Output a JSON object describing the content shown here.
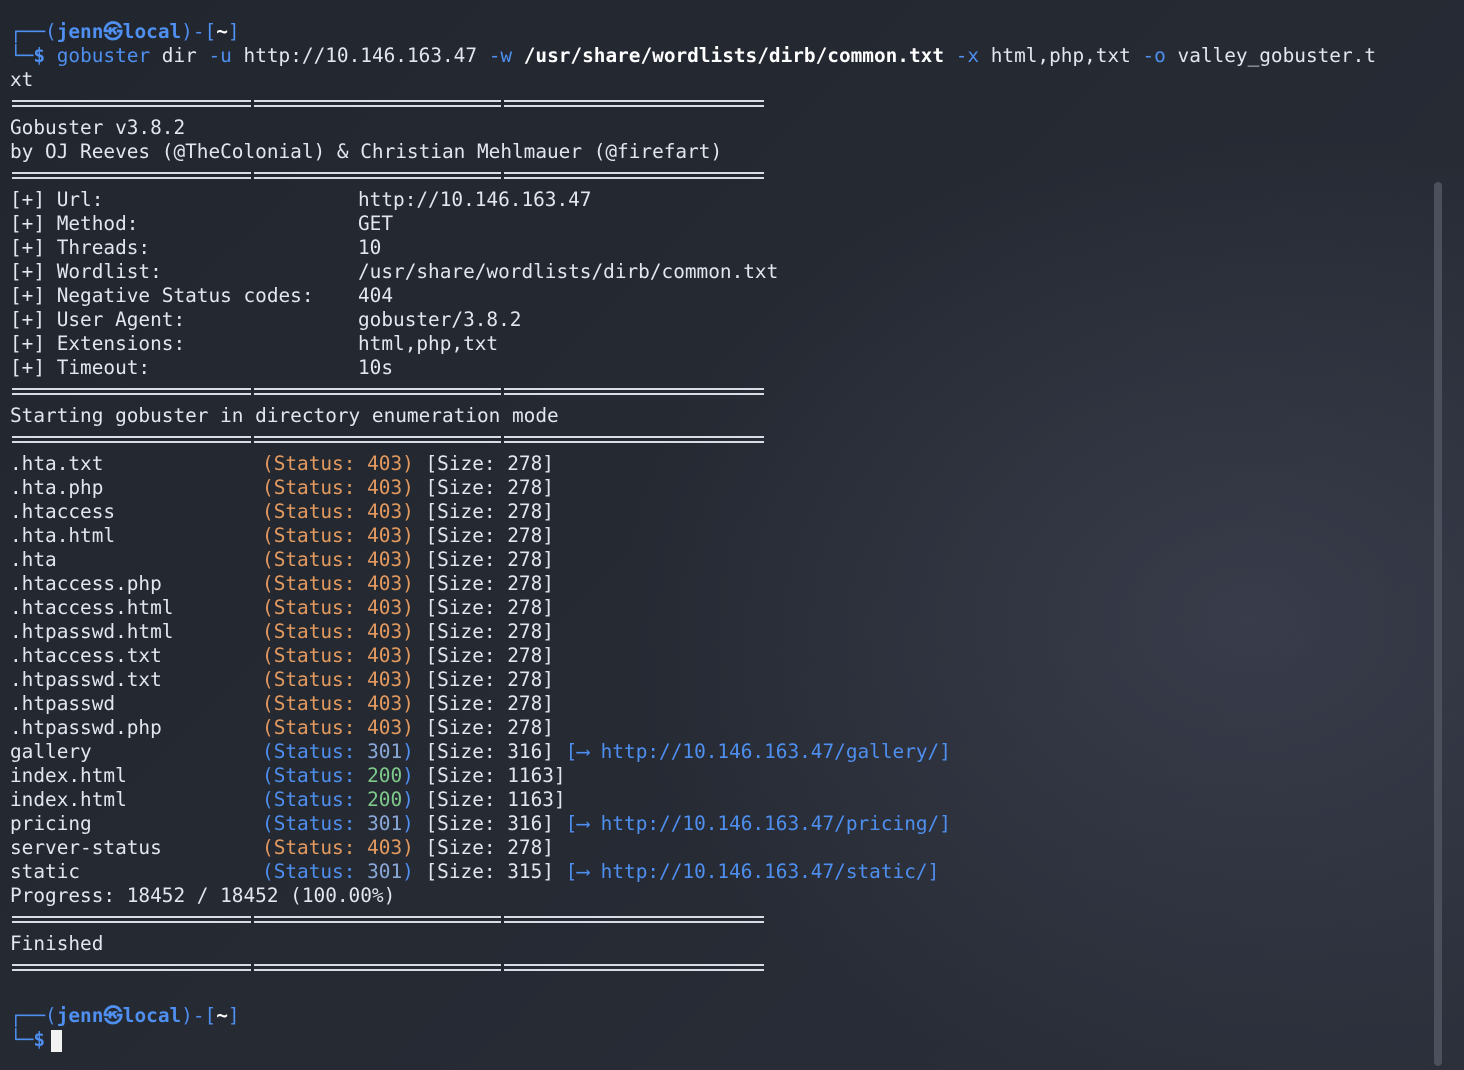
{
  "prompt": {
    "user": "jenn",
    "at_symbol": "㉿",
    "host": "local",
    "dir": "~"
  },
  "command": {
    "tool": "gobuster",
    "sub": " dir ",
    "opt_u": "-u",
    "url": " http://10.146.163.47 ",
    "opt_w": "-w",
    "wordlist": " /usr/share/wordlists/dirb/common.txt ",
    "opt_x": "-x",
    "ext": " html,php,txt ",
    "opt_o": "-o",
    "outfile": " valley_gobuster.t",
    "wrap": "xt"
  },
  "banner": {
    "version": "Gobuster v3.8.2",
    "authors": "by OJ Reeves (@TheColonial) & Christian Mehlmauer (@firefart)"
  },
  "config": [
    {
      "key": "[+] Url:",
      "value": "http://10.146.163.47"
    },
    {
      "key": "[+] Method:",
      "value": "GET"
    },
    {
      "key": "[+] Threads:",
      "value": "10"
    },
    {
      "key": "[+] Wordlist:",
      "value": "/usr/share/wordlists/dirb/common.txt"
    },
    {
      "key": "[+] Negative Status codes:",
      "value": "404"
    },
    {
      "key": "[+] User Agent:",
      "value": "gobuster/3.8.2"
    },
    {
      "key": "[+] Extensions:",
      "value": "html,php,txt"
    },
    {
      "key": "[+] Timeout:",
      "value": "10s"
    }
  ],
  "mode_message": "Starting gobuster in directory enumeration mode",
  "results": [
    {
      "name": ".hta.txt",
      "status": "403",
      "size": "278",
      "redirect": ""
    },
    {
      "name": ".hta.php",
      "status": "403",
      "size": "278",
      "redirect": ""
    },
    {
      "name": ".htaccess",
      "status": "403",
      "size": "278",
      "redirect": ""
    },
    {
      "name": ".hta.html",
      "status": "403",
      "size": "278",
      "redirect": ""
    },
    {
      "name": ".hta",
      "status": "403",
      "size": "278",
      "redirect": ""
    },
    {
      "name": ".htaccess.php",
      "status": "403",
      "size": "278",
      "redirect": ""
    },
    {
      "name": ".htaccess.html",
      "status": "403",
      "size": "278",
      "redirect": ""
    },
    {
      "name": ".htpasswd.html",
      "status": "403",
      "size": "278",
      "redirect": ""
    },
    {
      "name": ".htaccess.txt",
      "status": "403",
      "size": "278",
      "redirect": ""
    },
    {
      "name": ".htpasswd.txt",
      "status": "403",
      "size": "278",
      "redirect": ""
    },
    {
      "name": ".htpasswd",
      "status": "403",
      "size": "278",
      "redirect": ""
    },
    {
      "name": ".htpasswd.php",
      "status": "403",
      "size": "278",
      "redirect": ""
    },
    {
      "name": "gallery",
      "status": "301",
      "size": "316",
      "redirect": "http://10.146.163.47/gallery/"
    },
    {
      "name": "index.html",
      "status": "200",
      "size": "1163",
      "redirect": ""
    },
    {
      "name": "index.html",
      "status": "200",
      "size": "1163",
      "redirect": ""
    },
    {
      "name": "pricing",
      "status": "301",
      "size": "316",
      "redirect": "http://10.146.163.47/pricing/"
    },
    {
      "name": "server-status",
      "status": "403",
      "size": "278",
      "redirect": ""
    },
    {
      "name": "static",
      "status": "301",
      "size": "315",
      "redirect": "http://10.146.163.47/static/"
    }
  ],
  "labels": {
    "status": "Status: ",
    "size": "Size: ",
    "arrow": "⟶"
  },
  "progress": "Progress: 18452 / 18452 (100.00%)",
  "finished": "Finished",
  "colors": {
    "prompt_blue": "#4e8ff0",
    "status_403": "#e49a5f",
    "status_301": "#8aa9d8",
    "status_200": "#7fc98a",
    "background": "#23272f"
  }
}
